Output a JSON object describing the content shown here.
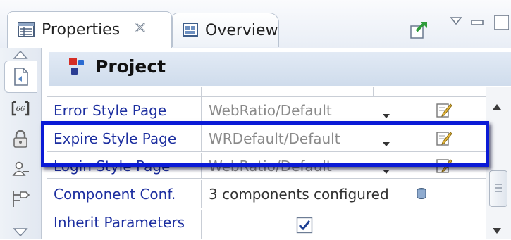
{
  "tabs": {
    "properties_label": "Properties",
    "overview_label": "Overview"
  },
  "panel": {
    "title": "Project"
  },
  "table": {
    "rows": [
      {
        "name": "Error Style Page",
        "value": "WebRatio/Default",
        "has_dropdown": true,
        "has_edit": true
      },
      {
        "name": "Expire Style Page",
        "value": "WRDefault/Default",
        "has_dropdown": true,
        "has_edit": true
      },
      {
        "name": "Login Style Page",
        "value": "WebRatio/Default",
        "has_dropdown": true,
        "has_edit": true
      },
      {
        "name": "Component Conf.",
        "value": "3 components configured",
        "has_dropdown": false,
        "has_edit": false
      },
      {
        "name": "Inherit Parameters",
        "value": "",
        "checked": true
      }
    ]
  },
  "colors": {
    "highlight": "#0a1ad6",
    "property_name": "#1d2fa0"
  }
}
